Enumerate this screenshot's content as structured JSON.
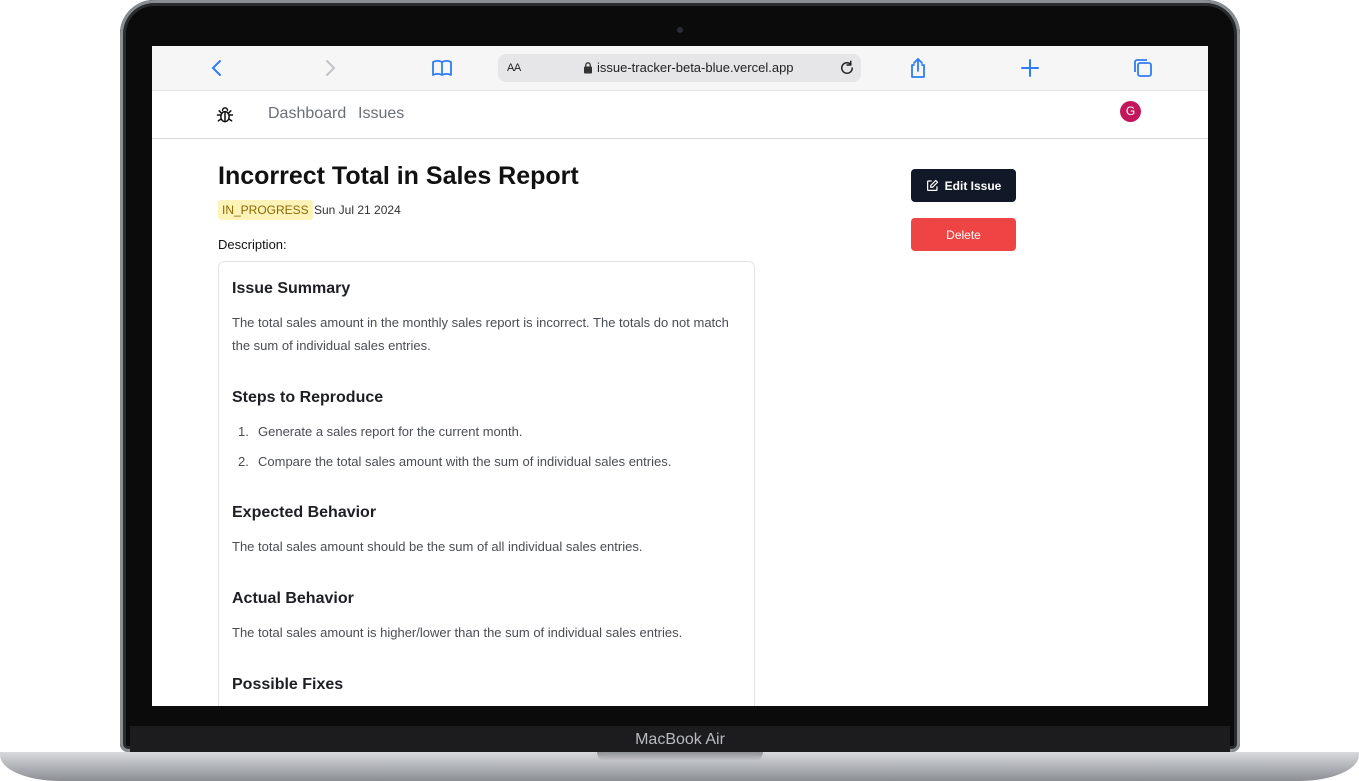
{
  "device": {
    "label": "MacBook Air"
  },
  "browser": {
    "text_size_label": "AA",
    "url": "issue-tracker-beta-blue.vercel.app",
    "accent": "#2f7cf6",
    "icons": [
      "back-icon",
      "forward-icon",
      "bookmarks-icon",
      "lock-icon",
      "reload-icon",
      "share-icon",
      "new-tab-icon",
      "tabs-icon"
    ]
  },
  "nav": {
    "logo_icon": "bug-icon",
    "links": [
      "Dashboard",
      "Issues"
    ],
    "avatar_initial": "G",
    "avatar_color": "#c2185b"
  },
  "issue": {
    "title": "Incorrect Total in Sales Report",
    "status": "IN_PROGRESS",
    "date": "Sun Jul 21 2024",
    "description_label": "Description:",
    "sections": {
      "summary_heading": "Issue Summary",
      "summary_text": "The total sales amount in the monthly sales report is incorrect. The totals do not match the sum of individual sales entries.",
      "steps_heading": "Steps to Reproduce",
      "steps": [
        {
          "num": "1.",
          "text": "Generate a sales report for the current month."
        },
        {
          "num": "2.",
          "text": "Compare the total sales amount with the sum of individual sales entries."
        }
      ],
      "expected_heading": "Expected Behavior",
      "expected_text": "The total sales amount should be the sum of all individual sales entries.",
      "actual_heading": "Actual Behavior",
      "actual_text": "The total sales amount is higher/lower than the sum of individual sales entries.",
      "fixes_heading": "Possible Fixes"
    }
  },
  "actions": {
    "edit_label": "Edit Issue",
    "delete_label": "Delete",
    "edit_color": "#111827",
    "delete_color": "#ef4444"
  }
}
